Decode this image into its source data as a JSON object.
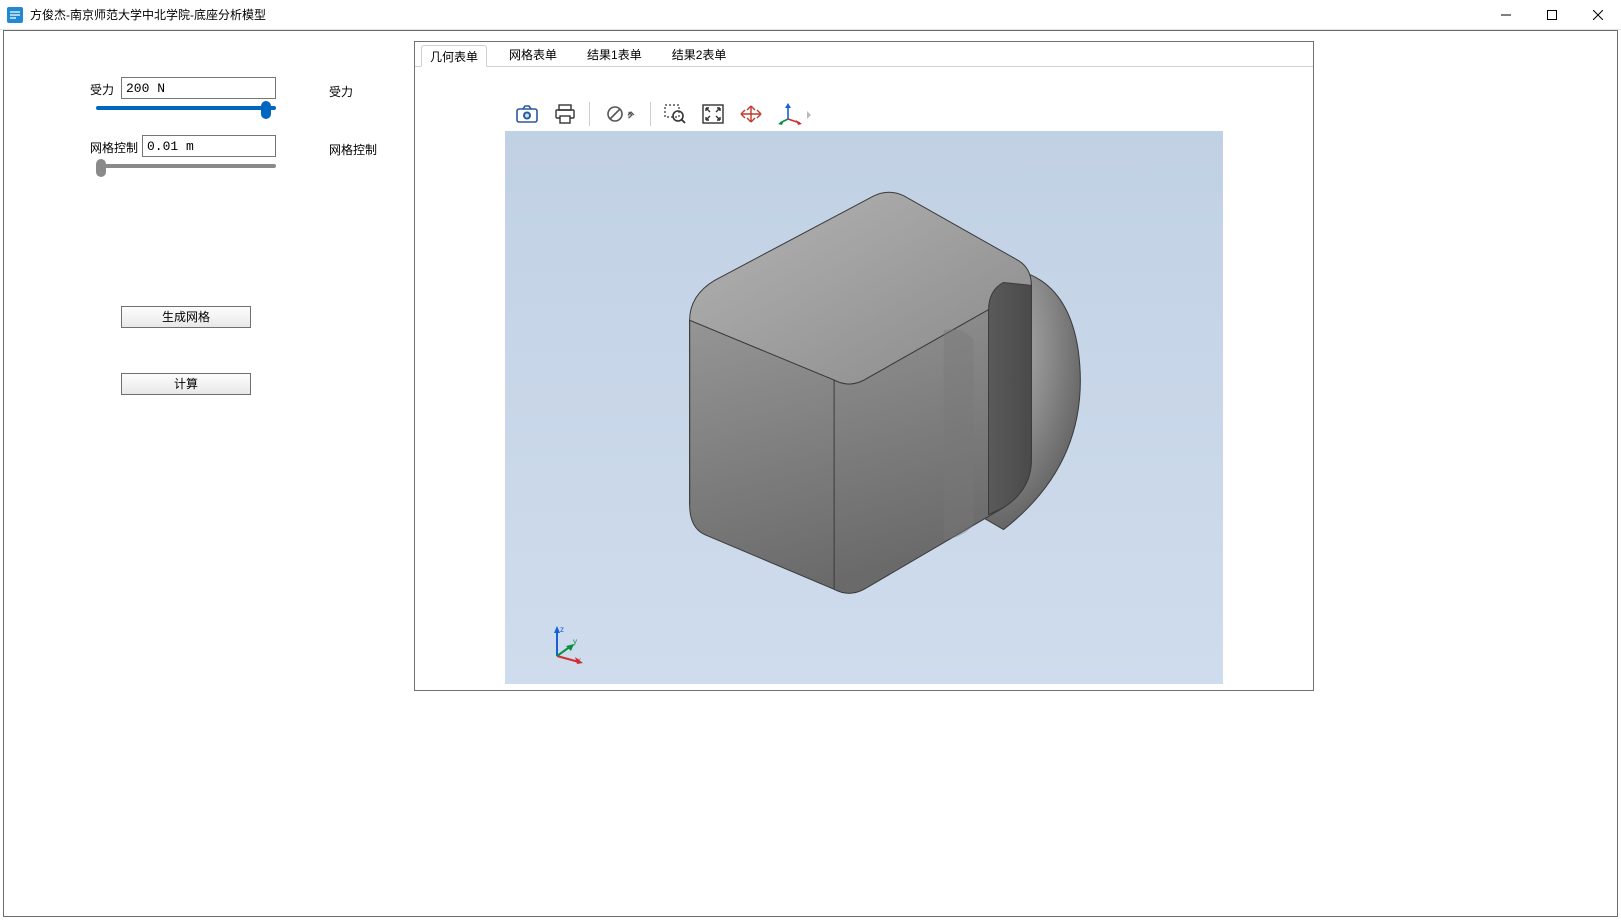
{
  "window": {
    "title": "方俊杰-南京师范大学中北学院-底座分析模型"
  },
  "side": {
    "force_label": "受力",
    "force_value": "200 N",
    "force_mirror": "受力",
    "mesh_label": "网格控制",
    "mesh_value": "0.01 m",
    "mesh_mirror": "网格控制",
    "btn_generate": "生成网格",
    "btn_compute": "计算"
  },
  "tabs": {
    "items": [
      "几何表单",
      "网格表单",
      "结果1表单",
      "结果2表单"
    ],
    "active_index": 0
  },
  "toolbar": {
    "camera": "camera-icon",
    "print": "print-icon",
    "annotate": "no-symbol-icon",
    "zoom_area": "zoom-area-icon",
    "fit": "fit-view-icon",
    "extents": "zoom-extents-icon",
    "orient": "axis-orient-icon"
  },
  "triad": {
    "x": "x",
    "y": "y",
    "z": "z"
  }
}
